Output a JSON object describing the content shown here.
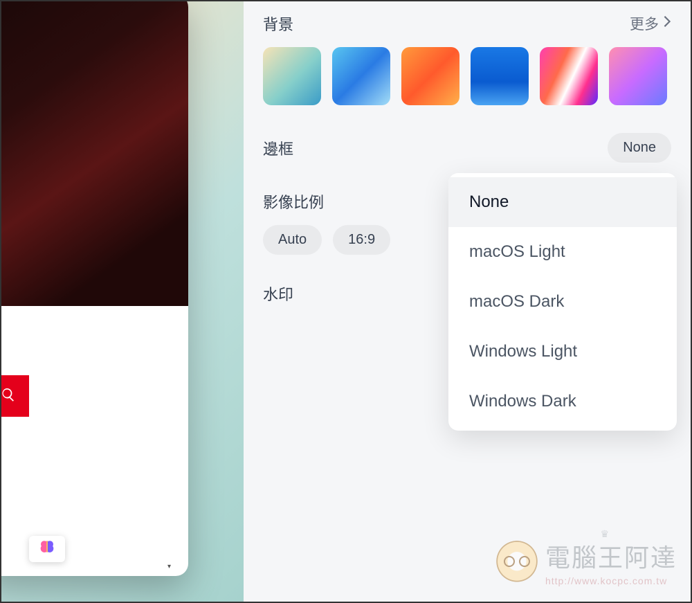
{
  "sections": {
    "background": {
      "title": "背景",
      "more": "更多"
    },
    "border": {
      "title": "邊框",
      "value": "None"
    },
    "aspect": {
      "title": "影像比例",
      "options": [
        "Auto",
        "16:9"
      ]
    },
    "watermark": {
      "title": "水印"
    }
  },
  "border_dropdown": {
    "selected": "None",
    "options": [
      "None",
      "macOS Light",
      "macOS Dark",
      "Windows Light",
      "Windows Dark"
    ]
  },
  "swatches": [
    "teal-sand",
    "blue",
    "orange",
    "deep-blue",
    "neon-pink",
    "pink-purple"
  ],
  "brand_watermark": {
    "name": "電腦王阿達",
    "url": "http://www.kocpc.com.tw"
  }
}
